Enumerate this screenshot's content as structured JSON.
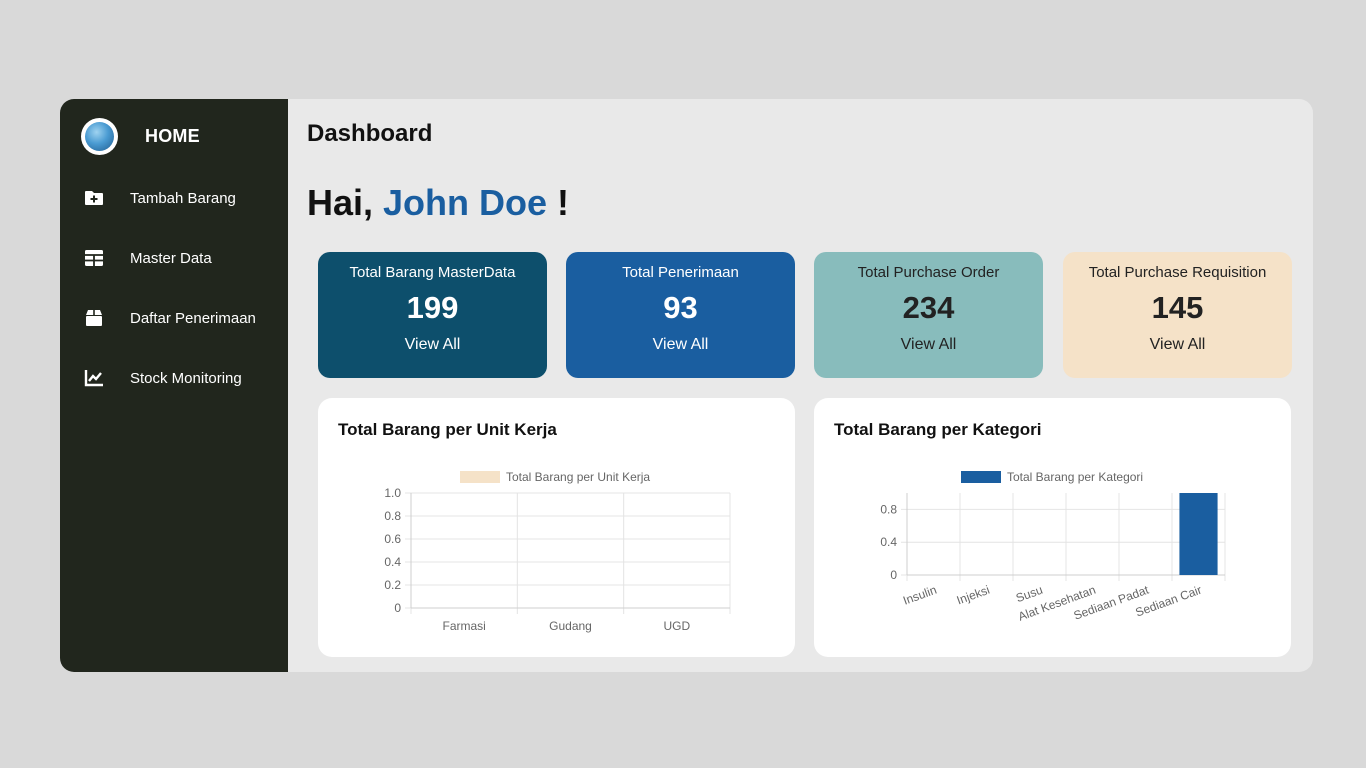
{
  "sidebar": {
    "home_label": "HOME",
    "items": [
      {
        "label": "Tambah Barang",
        "icon": "folder-plus-icon"
      },
      {
        "label": "Master Data",
        "icon": "table-icon"
      },
      {
        "label": "Daftar Penerimaan",
        "icon": "box-icon"
      },
      {
        "label": "Stock Monitoring",
        "icon": "chart-line-icon"
      }
    ]
  },
  "header": {
    "title": "Dashboard",
    "greeting_prefix": "Hai, ",
    "user_name": "John Doe",
    "greeting_suffix": " !"
  },
  "cards": [
    {
      "title": "Total Barang MasterData",
      "value": "199",
      "link": "View All",
      "bg": "#0d4f6c",
      "fg": "#ffffff"
    },
    {
      "title": "Total Penerimaan",
      "value": "93",
      "link": "View All",
      "bg": "#1a5ea0",
      "fg": "#ffffff"
    },
    {
      "title": "Total Purchase Order",
      "value": "234",
      "link": "View All",
      "bg": "#88bcbc",
      "fg": "#222222"
    },
    {
      "title": "Total Purchase Requisition",
      "value": "145",
      "link": "View All",
      "bg": "#f5e2c8",
      "fg": "#222222"
    }
  ],
  "chart_data": [
    {
      "type": "bar",
      "title": "Total Barang per Unit Kerja",
      "categories": [
        "Farmasi",
        "Gudang",
        "UGD"
      ],
      "series": [
        {
          "name": "Total Barang per Unit Kerja",
          "values": [
            0,
            0,
            0
          ],
          "color": "#f5e2c8"
        }
      ],
      "ylim": [
        0,
        1.0
      ],
      "yticks": [
        "0",
        "0.2",
        "0.4",
        "0.6",
        "0.8",
        "1.0"
      ],
      "legend": "top",
      "grid": true
    },
    {
      "type": "bar",
      "title": "Total Barang per Kategori",
      "categories": [
        "Insulin",
        "Injeksi",
        "Susu",
        "Alat Kesehatan",
        "Sediaan Padat",
        "Sediaan Cair"
      ],
      "series": [
        {
          "name": "Total Barang per Kategori",
          "values": [
            0,
            0,
            0,
            0,
            0,
            1
          ],
          "color": "#1a5ea0"
        }
      ],
      "ylim": [
        0,
        1.0
      ],
      "yticks": [
        "0",
        "0.4",
        "0.8"
      ],
      "legend": "top",
      "grid": true
    }
  ]
}
